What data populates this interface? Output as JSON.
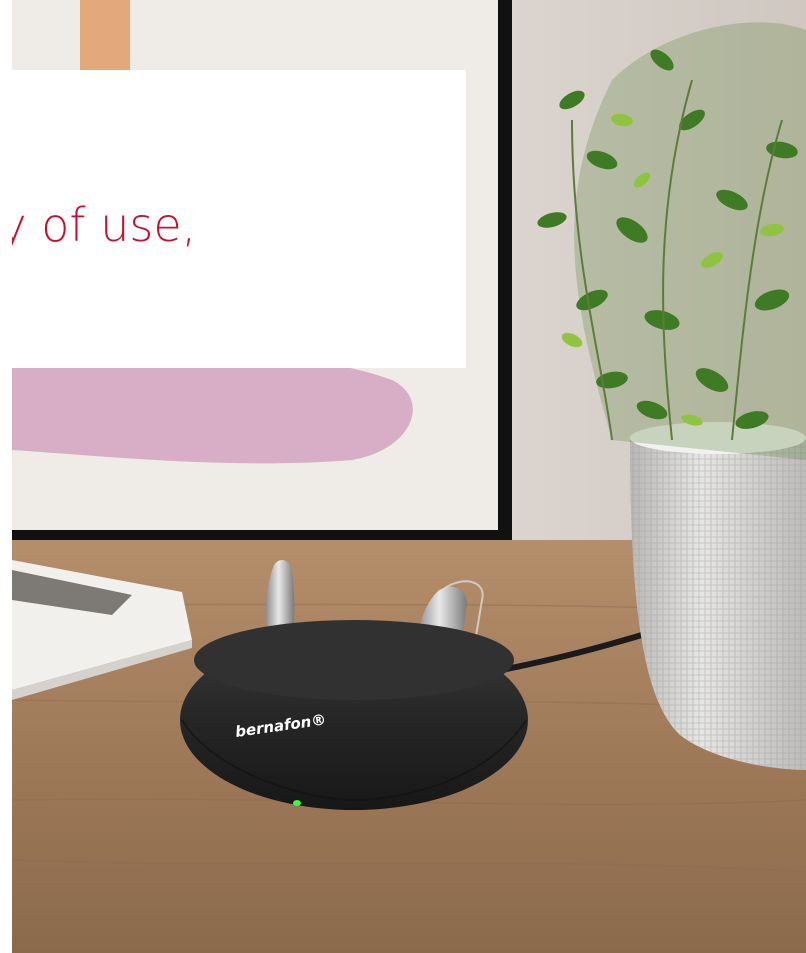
{
  "headline": "day of use,\ning",
  "brand_logo_text": "bernafon®",
  "colors": {
    "headline": "#c8102e",
    "wall": "#d9d3ce",
    "table": "#a6805f",
    "charger": "#2b2b2b",
    "charging_led": "#39ff3a",
    "pot": "#d8d8d6"
  }
}
